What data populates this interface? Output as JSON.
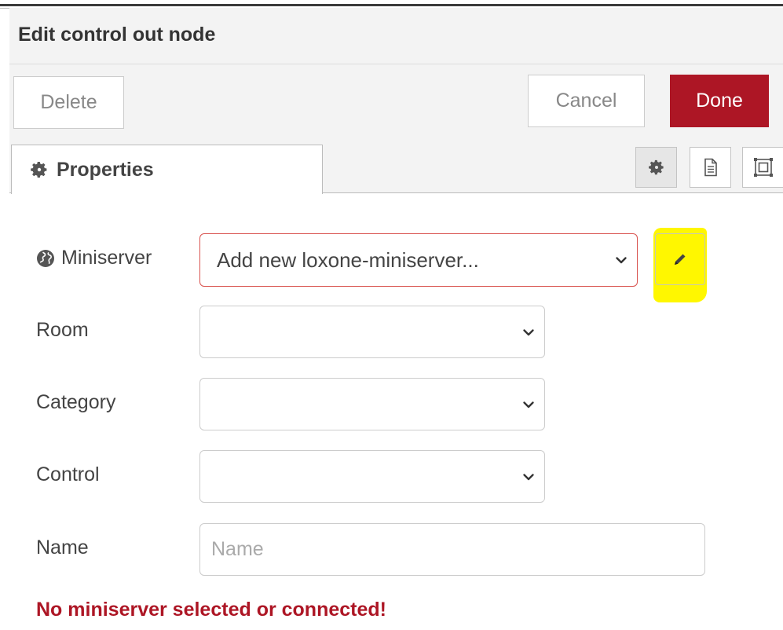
{
  "dialog": {
    "title": "Edit control out node"
  },
  "toolbar": {
    "delete_label": "Delete",
    "cancel_label": "Cancel",
    "done_label": "Done",
    "done_color": "#ad1625"
  },
  "tabs": {
    "properties_label": "Properties",
    "properties_icon": "gear-icon",
    "side_buttons": [
      "gear-icon",
      "document-icon",
      "frame-icon"
    ]
  },
  "form": {
    "miniserver": {
      "label": "Miniserver",
      "icon": "globe-icon",
      "value": "Add new loxone-miniserver...",
      "edit_icon": "pencil-icon",
      "highlight_color": "#fff700",
      "invalid_border_color": "#d9534f"
    },
    "room": {
      "label": "Room",
      "value": ""
    },
    "category": {
      "label": "Category",
      "value": ""
    },
    "control": {
      "label": "Control",
      "value": ""
    },
    "name": {
      "label": "Name",
      "value": "",
      "placeholder": "Name"
    }
  },
  "error": {
    "message": "No miniserver selected or connected!",
    "color": "#ad1625"
  }
}
